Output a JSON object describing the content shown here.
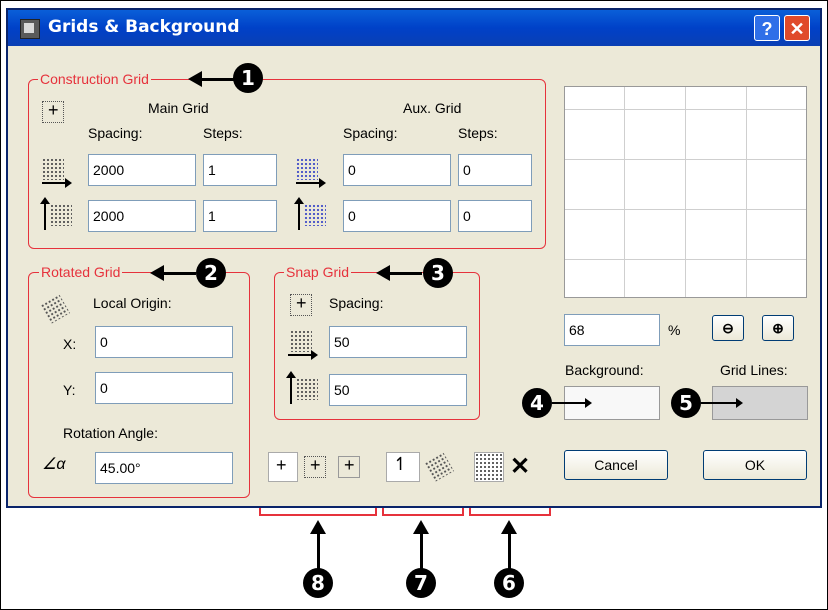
{
  "window": {
    "title": "Grids & Background",
    "help_label": "?",
    "close_label": "✕"
  },
  "construction_grid": {
    "legend": "Construction Grid",
    "main_grid_label": "Main Grid",
    "aux_grid_label": "Aux. Grid",
    "spacing_label": "Spacing:",
    "steps_label": "Steps:",
    "main_spacing_x": "2000",
    "main_steps_x": "1",
    "main_spacing_y": "2000",
    "main_steps_y": "1",
    "aux_spacing_x": "0",
    "aux_steps_x": "0",
    "aux_spacing_y": "0",
    "aux_steps_y": "0"
  },
  "rotated_grid": {
    "legend": "Rotated Grid",
    "local_origin_label": "Local Origin:",
    "x_label": "X:",
    "x_value": "0",
    "y_label": "Y:",
    "y_value": "0",
    "rotation_label": "Rotation Angle:",
    "rotation_value": "45.00°"
  },
  "snap_grid": {
    "legend": "Snap Grid",
    "spacing_label": "Spacing:",
    "spacing_x": "50",
    "spacing_y": "50"
  },
  "preview": {
    "zoom_value": "68",
    "zoom_unit": "%",
    "background_label": "Background:",
    "grid_lines_label": "Grid Lines:",
    "background_color": "#f8f8f8",
    "grid_lines_color": "#d4d4d4"
  },
  "buttons": {
    "cancel": "Cancel",
    "ok": "OK"
  },
  "callouts": [
    "1",
    "2",
    "3",
    "4",
    "5",
    "6",
    "7",
    "8"
  ],
  "colors": {
    "accent": "#e6323c",
    "titlebar": "#0041c8"
  }
}
